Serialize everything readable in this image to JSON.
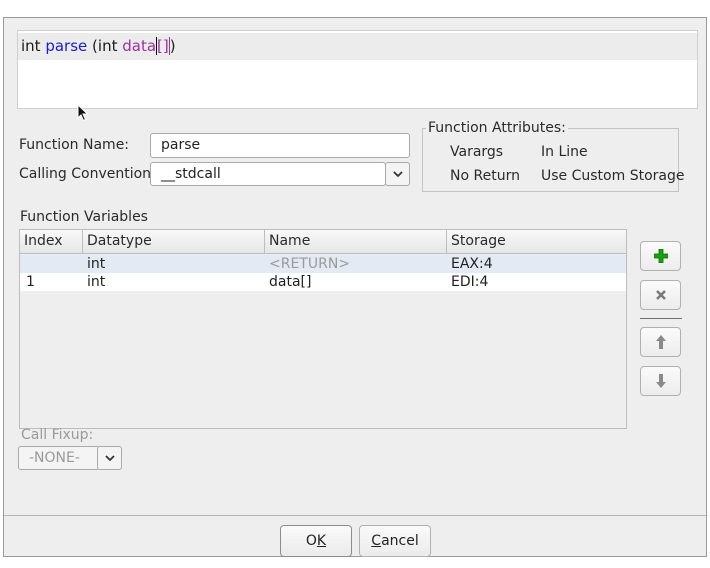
{
  "signature": {
    "return_type": "int",
    "function_name": "parse",
    "open_paren": " (",
    "param_type": "int",
    "param_name": "data",
    "param_suffix": "[]",
    "close_paren": ")"
  },
  "form": {
    "function_name_label": "Function Name:",
    "function_name_value": "parse",
    "calling_convention_label": "Calling Convention",
    "calling_convention_value": "__stdcall"
  },
  "attributes": {
    "title": "Function Attributes:",
    "varargs": "Varargs",
    "in_line": "In Line",
    "no_return": "No Return",
    "use_custom_storage": "Use Custom Storage"
  },
  "variables": {
    "label": "Function Variables",
    "columns": [
      "Index",
      "Datatype",
      "Name",
      "Storage"
    ],
    "rows": [
      {
        "index": "",
        "datatype": "int",
        "name": "<RETURN>",
        "storage": "EAX:4"
      },
      {
        "index": "1",
        "datatype": "int",
        "name": "data[]",
        "storage": "EDI:4"
      }
    ]
  },
  "side_buttons": {
    "add_icon": "plus-icon",
    "remove_icon": "x-icon",
    "up_icon": "arrow-up-icon",
    "down_icon": "arrow-down-icon"
  },
  "call_fixup": {
    "label": "Call Fixup:",
    "value": "-NONE-"
  },
  "buttons": {
    "ok_pre": "O",
    "ok_mnemonic": "K",
    "cancel_mnemonic": "C",
    "cancel_rest": "ancel"
  },
  "colors": {
    "function_name": "#1b1bd6",
    "parameter": "#9b30a0",
    "selected_row": "#e4eaf4",
    "add_green": "#17a30f"
  }
}
